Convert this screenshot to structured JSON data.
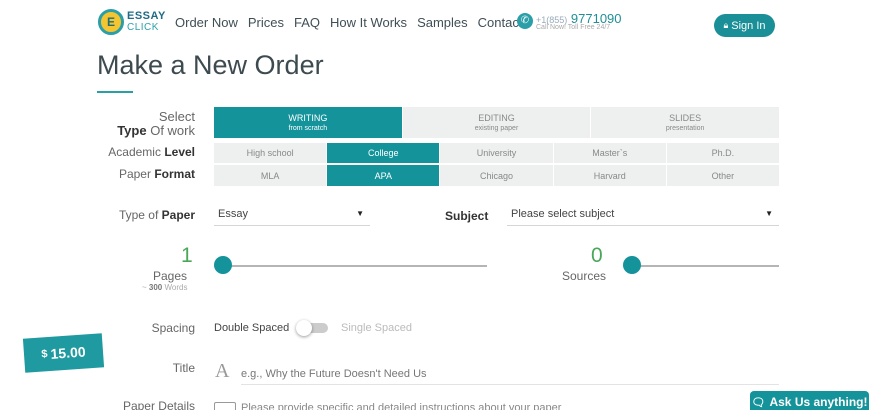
{
  "header": {
    "logo_badge": "E",
    "logo_line1": "ESSAY",
    "logo_line2": "CLICK",
    "nav": [
      "Order Now",
      "Prices",
      "FAQ",
      "How It Works",
      "Samples",
      "Contacts"
    ],
    "phone_prefix": "+1(855)",
    "phone_number": "9771090",
    "phone_sub": "Call Now! Toll Free 24/7",
    "signin_label": "Sign In"
  },
  "page_title": "Make a New Order",
  "work_type": {
    "label_line1": "Select",
    "label_bold": "Type",
    "label_rest": "Of work",
    "options": [
      {
        "label": "WRITING",
        "sub": "from scratch",
        "active": true
      },
      {
        "label": "EDITING",
        "sub": "existing paper",
        "active": false
      },
      {
        "label": "SLIDES",
        "sub": "presentation",
        "active": false
      }
    ]
  },
  "level": {
    "label_pre": "Academic",
    "label_bold": "Level",
    "options": [
      "High school",
      "College",
      "University",
      "Master`s",
      "Ph.D."
    ],
    "selected": "College"
  },
  "format": {
    "label_pre": "Paper",
    "label_bold": "Format",
    "options": [
      "MLA",
      "APA",
      "Chicago",
      "Harvard",
      "Other"
    ],
    "selected": "APA"
  },
  "type_of_paper": {
    "label_pre": "Type of",
    "label_bold": "Paper",
    "value": "Essay"
  },
  "subject": {
    "label": "Subject",
    "value": "Please select subject"
  },
  "pages": {
    "value": "1",
    "label": "Pages",
    "words_pre": "~",
    "words_value": "300",
    "words_post": "Words",
    "slider_fraction": 0
  },
  "sources": {
    "value": "0",
    "label": "Sources",
    "slider_fraction": 0
  },
  "spacing": {
    "label": "Spacing",
    "option_on": "Double Spaced",
    "option_off": "Single Spaced"
  },
  "price": {
    "currency": "$",
    "amount": "15.00"
  },
  "title_field": {
    "label": "Title",
    "icon": "A",
    "placeholder": "e.g., Why the Future Doesn't Need Us"
  },
  "details_field": {
    "label": "Paper Details",
    "placeholder": "Please provide specific and detailed instructions about your paper"
  },
  "chat": {
    "label": "Ask Us anything!"
  },
  "colors": {
    "accent": "#14939b",
    "number": "#4aa75a"
  }
}
